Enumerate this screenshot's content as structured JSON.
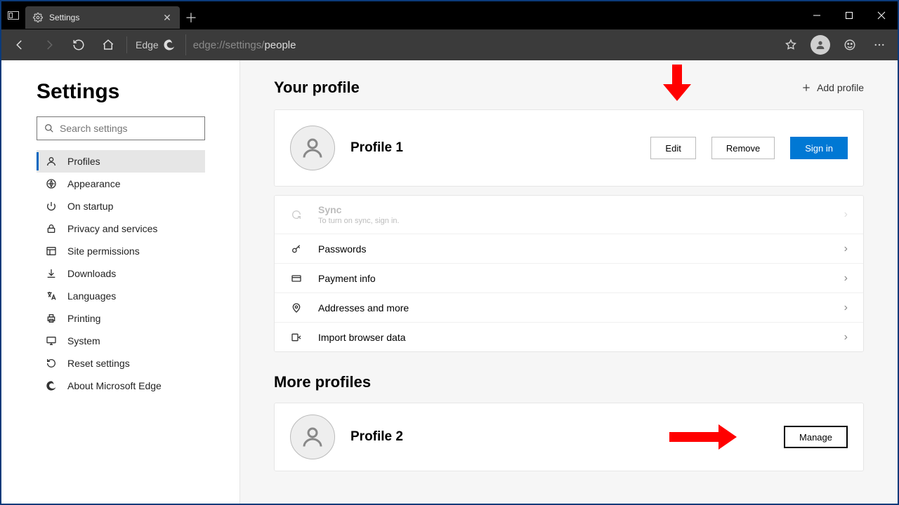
{
  "tab": {
    "title": "Settings"
  },
  "toolbar": {
    "edge_label": "Edge",
    "url_dim": "edge://settings/",
    "url_bright": "people"
  },
  "sidebar": {
    "title": "Settings",
    "search_placeholder": "Search settings",
    "items": [
      {
        "label": "Profiles"
      },
      {
        "label": "Appearance"
      },
      {
        "label": "On startup"
      },
      {
        "label": "Privacy and services"
      },
      {
        "label": "Site permissions"
      },
      {
        "label": "Downloads"
      },
      {
        "label": "Languages"
      },
      {
        "label": "Printing"
      },
      {
        "label": "System"
      },
      {
        "label": "Reset settings"
      },
      {
        "label": "About Microsoft Edge"
      }
    ]
  },
  "main": {
    "your_profile": "Your profile",
    "add_profile": "Add profile",
    "profile1_name": "Profile 1",
    "edit": "Edit",
    "remove": "Remove",
    "signin": "Sign in",
    "sync_title": "Sync",
    "sync_sub": "To turn on sync, sign in.",
    "rows": [
      {
        "label": "Passwords"
      },
      {
        "label": "Payment info"
      },
      {
        "label": "Addresses and more"
      },
      {
        "label": "Import browser data"
      }
    ],
    "more_profiles": "More profiles",
    "profile2_name": "Profile 2",
    "manage": "Manage"
  }
}
